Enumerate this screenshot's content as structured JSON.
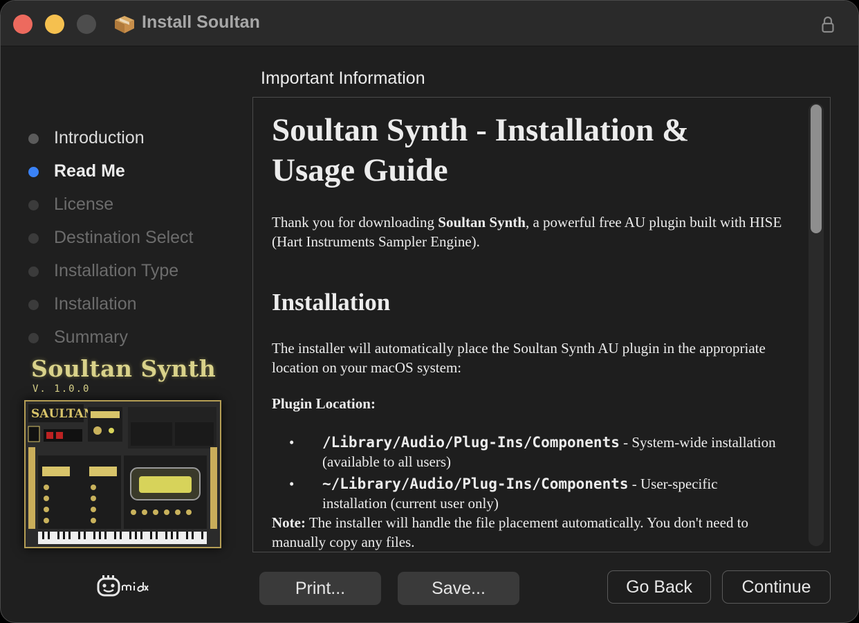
{
  "window": {
    "title": "Install Soultan",
    "icons": {
      "app": "package-icon",
      "lock": "lock-icon"
    }
  },
  "sidebar": {
    "steps": [
      {
        "label": "Introduction",
        "state": "done"
      },
      {
        "label": "Read Me",
        "state": "current"
      },
      {
        "label": "License",
        "state": "todo"
      },
      {
        "label": "Destination Select",
        "state": "todo"
      },
      {
        "label": "Installation Type",
        "state": "todo"
      },
      {
        "label": "Installation",
        "state": "todo"
      },
      {
        "label": "Summary",
        "state": "todo"
      }
    ],
    "brand": {
      "title": "Soultan Synth",
      "version": "V. 1.0.0"
    }
  },
  "main": {
    "section_title": "Important Information",
    "document": {
      "heading": "Soultan Synth - Installation & Usage Guide",
      "intro_before": "Thank you for downloading ",
      "intro_bold": "Soultan Synth",
      "intro_after": ", a powerful free AU plugin built with HISE (Hart Instruments Sampler Engine).",
      "installation_heading": "Installation",
      "installation_text": "The installer will automatically place the Soultan Synth AU plugin in the appropriate location on your macOS system:",
      "plugin_location_label": "Plugin Location:",
      "locations": [
        {
          "path": "/Library/Audio/Plug-Ins/Components",
          "desc": " - System-wide installation (available to all users)"
        },
        {
          "path": "~/Library/Audio/Plug-Ins/Components",
          "desc": " - User-specific installation (current user only)"
        }
      ],
      "note_label": "Note:",
      "note_text": " The installer will handle the file placement automatically. You don't need to manually copy any files."
    }
  },
  "buttons": {
    "print": "Print...",
    "save": "Save...",
    "go_back": "Go Back",
    "continue": "Continue"
  },
  "colors": {
    "current_step": "#3a82f7",
    "brand_gold": "#d9d28a"
  }
}
